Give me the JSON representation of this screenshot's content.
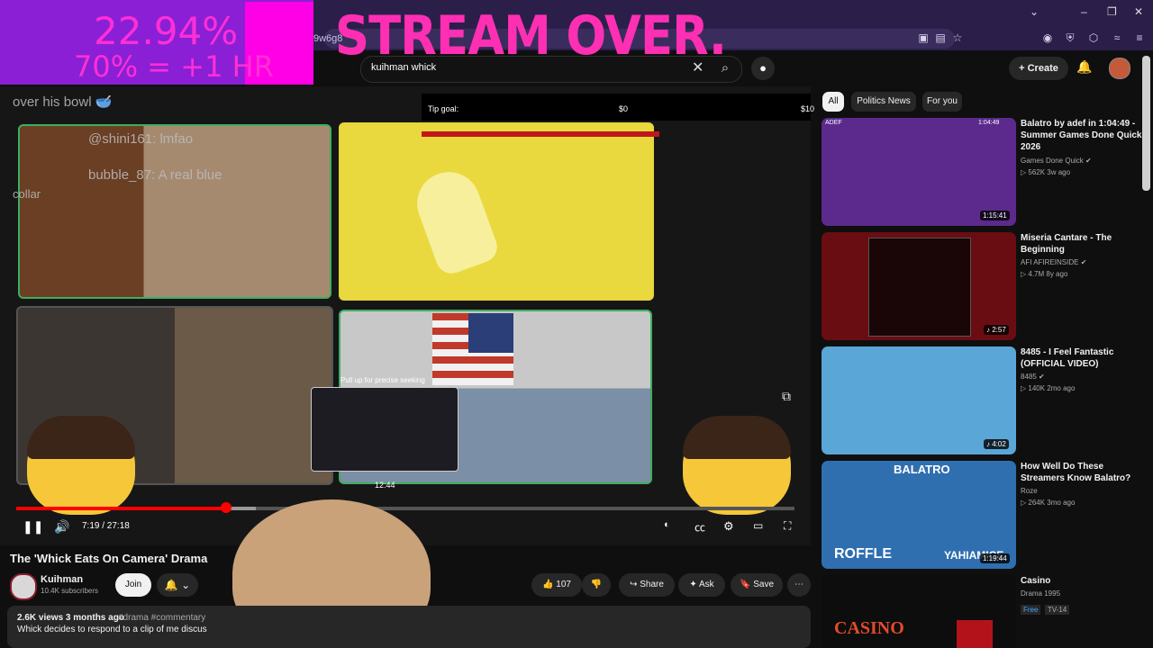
{
  "browser": {
    "url_fragment": "9w6g8",
    "window_controls": [
      "⌄",
      "–",
      "❐",
      "✕"
    ]
  },
  "overlay": {
    "percent": "22.94%",
    "bonus": "70% = +1 HR",
    "banner": "STREAM OVER."
  },
  "search": {
    "query": "kuihman whick",
    "clear": "✕",
    "search_icon": "⌕",
    "mic_icon": "🎙"
  },
  "header": {
    "create_label": "Create",
    "bell_icon": "🔔"
  },
  "player": {
    "chat": [
      {
        "text": "over his bowl 🥣"
      },
      {
        "text": "@shini161: lmfao"
      },
      {
        "text": "bubble_87: A real blue"
      },
      {
        "text": "collar"
      }
    ],
    "tip_goal_label": "Tip goal:",
    "tip_goal_value": "$0",
    "tip_goal_max": "$10",
    "preview_hint": "Pull up for precise seeking",
    "preview_time": "12:44",
    "time_display": "7:19 / 27:18",
    "progress_fraction": 0.27
  },
  "video": {
    "title": "The 'Whick Eats On Camera' Drama",
    "channel": "Kuihman",
    "subscribers": "10.4K subscribers",
    "join_label": "Join",
    "likes": "107",
    "share_label": "Share",
    "ask_label": "Ask",
    "save_label": "Save",
    "views_date": "2.6K views  3 months ago",
    "tags": "#drama #commentary",
    "description": "Whick decides to respond to a clip of me discus"
  },
  "chips": [
    "All",
    "Politics News",
    "For you"
  ],
  "related": [
    {
      "title": "Balatro by adef in 1:04:49 - Summer Games Done Quick 2026",
      "channel": "Games Done Quick",
      "verified": true,
      "meta": "562K  3w ago",
      "duration": "1:15:41",
      "thumb_color": "#5b2a8c",
      "corner_label": "ADEF",
      "corner_time": "1:04:49"
    },
    {
      "title": "Miseria Cantare - The Beginning",
      "channel": "AFI AFIREINSIDE",
      "verified": true,
      "meta": "4.7M  8y ago",
      "duration": "2:57",
      "thumb_color": "#6a0d12"
    },
    {
      "title": "8485 - I Feel Fantastic (OFFICIAL VIDEO)",
      "channel": "8485",
      "verified": true,
      "meta": "140K  2mo ago",
      "duration": "4:02",
      "thumb_color": "#5aa6d6"
    },
    {
      "title": "How Well Do These Streamers Know Balatro?",
      "channel": "Roze",
      "verified": false,
      "meta": "264K  3mo ago",
      "duration": "1:19:44",
      "thumb_color": "#2f6fb0",
      "thumb_left": "ROFFLE",
      "thumb_right": "YAHIAMICE",
      "thumb_top": "BALATRO"
    },
    {
      "title": "Casino",
      "channel": "Drama 1995",
      "verified": false,
      "meta_badges": [
        "Free",
        "TV-14"
      ],
      "thumb_color": "#0d0d0d",
      "thumb_text": "CASINO"
    }
  ]
}
